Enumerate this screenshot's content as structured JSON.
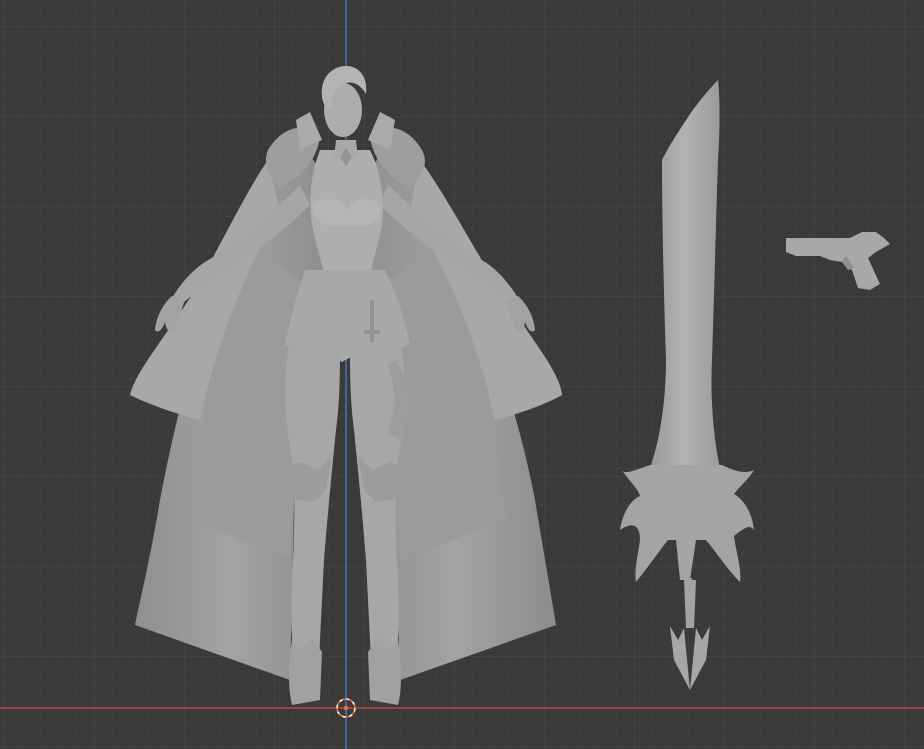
{
  "viewport": {
    "view": "front-orthographic",
    "shading": "solid",
    "background_color": "#3a3a3a",
    "grid_minor_color": "#444444",
    "grid_major_color": "#4a4a4a",
    "x_axis_color": "#b34a4f",
    "z_axis_color": "#3f79b5",
    "model_color": "#a6a6a6",
    "cursor_color": "#e8702a"
  },
  "scene": {
    "objects": [
      {
        "name": "female-character-with-cape",
        "type": "mesh"
      },
      {
        "name": "greatsword",
        "type": "mesh"
      },
      {
        "name": "pistol",
        "type": "mesh"
      }
    ],
    "cursor": "3d-cursor-icon"
  }
}
